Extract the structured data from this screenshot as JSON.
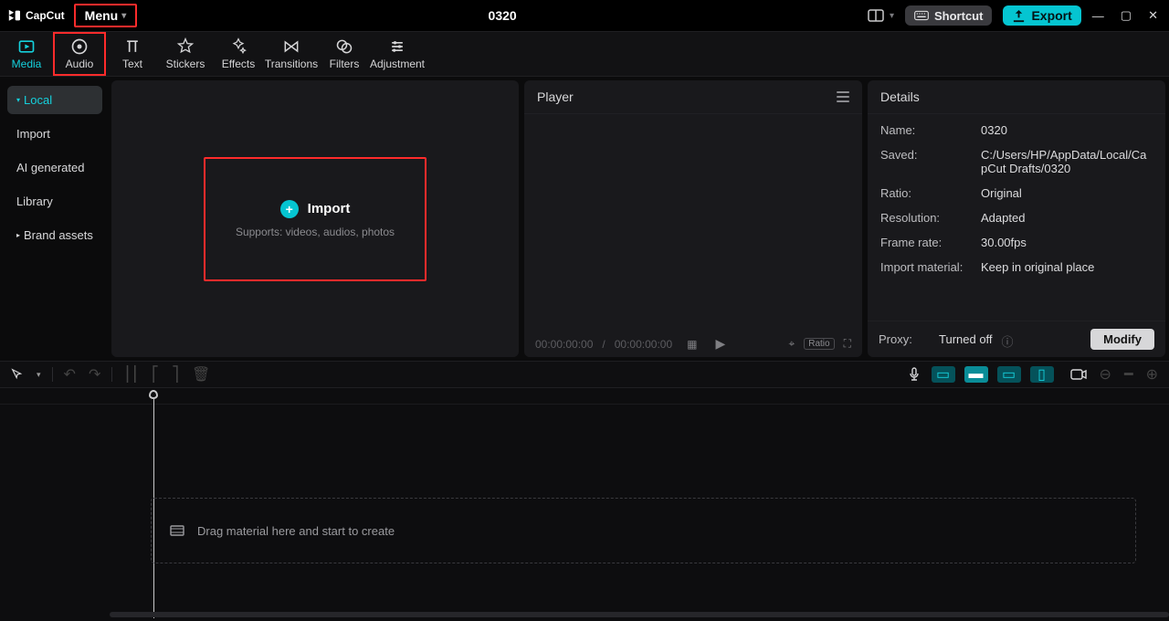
{
  "app": {
    "name": "CapCut",
    "menuLabel": "Menu",
    "projectTitle": "0320"
  },
  "titlebar": {
    "shortcut": "Shortcut",
    "export": "Export"
  },
  "tabs": [
    {
      "id": "media",
      "label": "Media"
    },
    {
      "id": "audio",
      "label": "Audio"
    },
    {
      "id": "text",
      "label": "Text"
    },
    {
      "id": "stickers",
      "label": "Stickers"
    },
    {
      "id": "effects",
      "label": "Effects"
    },
    {
      "id": "transitions",
      "label": "Transitions"
    },
    {
      "id": "filters",
      "label": "Filters"
    },
    {
      "id": "adjustment",
      "label": "Adjustment"
    }
  ],
  "sidebar": {
    "items": [
      {
        "label": "Local",
        "expandable": true,
        "active": true
      },
      {
        "label": "Import",
        "expandable": false,
        "active": false
      },
      {
        "label": "AI generated",
        "expandable": false,
        "active": false
      },
      {
        "label": "Library",
        "expandable": false,
        "active": false
      },
      {
        "label": "Brand assets",
        "expandable": true,
        "active": false
      }
    ]
  },
  "importBox": {
    "title": "Import",
    "subtitle": "Supports: videos, audios, photos"
  },
  "player": {
    "title": "Player",
    "timeCurrent": "00:00:00:00",
    "timeTotal": "00:00:00:00",
    "ratioPill": "Ratio"
  },
  "details": {
    "title": "Details",
    "rows": [
      {
        "k": "Name:",
        "v": "0320"
      },
      {
        "k": "Saved:",
        "v": "C:/Users/HP/AppData/Local/CapCut Drafts/0320"
      },
      {
        "k": "Ratio:",
        "v": "Original"
      },
      {
        "k": "Resolution:",
        "v": "Adapted"
      },
      {
        "k": "Frame rate:",
        "v": "30.00fps"
      },
      {
        "k": "Import material:",
        "v": "Keep in original place"
      }
    ],
    "proxy": {
      "k": "Proxy:",
      "v": "Turned off"
    },
    "modify": "Modify"
  },
  "timeline": {
    "dropHint": "Drag material here and start to create"
  }
}
